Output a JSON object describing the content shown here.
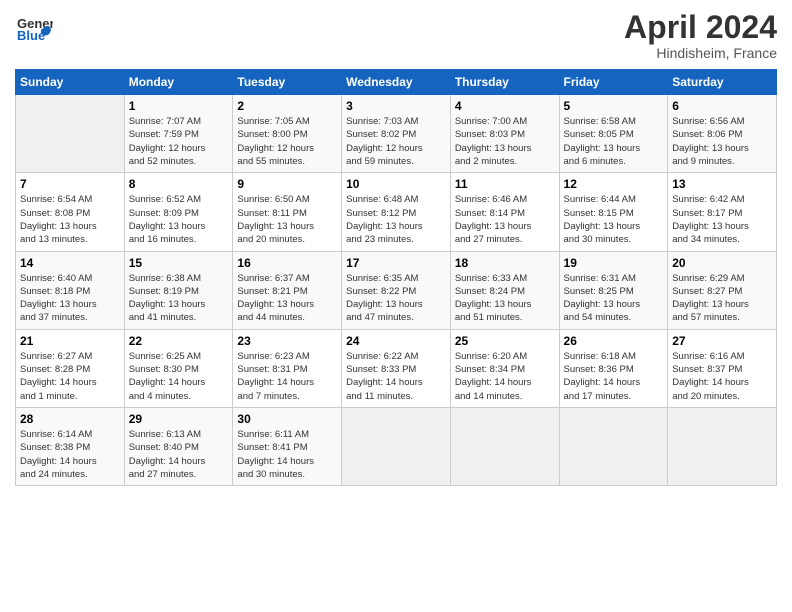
{
  "header": {
    "logo_general": "General",
    "logo_blue": "Blue",
    "title": "April 2024",
    "location": "Hindisheim, France"
  },
  "columns": [
    "Sunday",
    "Monday",
    "Tuesday",
    "Wednesday",
    "Thursday",
    "Friday",
    "Saturday"
  ],
  "weeks": [
    [
      {
        "day": "",
        "info": ""
      },
      {
        "day": "1",
        "info": "Sunrise: 7:07 AM\nSunset: 7:59 PM\nDaylight: 12 hours\nand 52 minutes."
      },
      {
        "day": "2",
        "info": "Sunrise: 7:05 AM\nSunset: 8:00 PM\nDaylight: 12 hours\nand 55 minutes."
      },
      {
        "day": "3",
        "info": "Sunrise: 7:03 AM\nSunset: 8:02 PM\nDaylight: 12 hours\nand 59 minutes."
      },
      {
        "day": "4",
        "info": "Sunrise: 7:00 AM\nSunset: 8:03 PM\nDaylight: 13 hours\nand 2 minutes."
      },
      {
        "day": "5",
        "info": "Sunrise: 6:58 AM\nSunset: 8:05 PM\nDaylight: 13 hours\nand 6 minutes."
      },
      {
        "day": "6",
        "info": "Sunrise: 6:56 AM\nSunset: 8:06 PM\nDaylight: 13 hours\nand 9 minutes."
      }
    ],
    [
      {
        "day": "7",
        "info": "Sunrise: 6:54 AM\nSunset: 8:08 PM\nDaylight: 13 hours\nand 13 minutes."
      },
      {
        "day": "8",
        "info": "Sunrise: 6:52 AM\nSunset: 8:09 PM\nDaylight: 13 hours\nand 16 minutes."
      },
      {
        "day": "9",
        "info": "Sunrise: 6:50 AM\nSunset: 8:11 PM\nDaylight: 13 hours\nand 20 minutes."
      },
      {
        "day": "10",
        "info": "Sunrise: 6:48 AM\nSunset: 8:12 PM\nDaylight: 13 hours\nand 23 minutes."
      },
      {
        "day": "11",
        "info": "Sunrise: 6:46 AM\nSunset: 8:14 PM\nDaylight: 13 hours\nand 27 minutes."
      },
      {
        "day": "12",
        "info": "Sunrise: 6:44 AM\nSunset: 8:15 PM\nDaylight: 13 hours\nand 30 minutes."
      },
      {
        "day": "13",
        "info": "Sunrise: 6:42 AM\nSunset: 8:17 PM\nDaylight: 13 hours\nand 34 minutes."
      }
    ],
    [
      {
        "day": "14",
        "info": "Sunrise: 6:40 AM\nSunset: 8:18 PM\nDaylight: 13 hours\nand 37 minutes."
      },
      {
        "day": "15",
        "info": "Sunrise: 6:38 AM\nSunset: 8:19 PM\nDaylight: 13 hours\nand 41 minutes."
      },
      {
        "day": "16",
        "info": "Sunrise: 6:37 AM\nSunset: 8:21 PM\nDaylight: 13 hours\nand 44 minutes."
      },
      {
        "day": "17",
        "info": "Sunrise: 6:35 AM\nSunset: 8:22 PM\nDaylight: 13 hours\nand 47 minutes."
      },
      {
        "day": "18",
        "info": "Sunrise: 6:33 AM\nSunset: 8:24 PM\nDaylight: 13 hours\nand 51 minutes."
      },
      {
        "day": "19",
        "info": "Sunrise: 6:31 AM\nSunset: 8:25 PM\nDaylight: 13 hours\nand 54 minutes."
      },
      {
        "day": "20",
        "info": "Sunrise: 6:29 AM\nSunset: 8:27 PM\nDaylight: 13 hours\nand 57 minutes."
      }
    ],
    [
      {
        "day": "21",
        "info": "Sunrise: 6:27 AM\nSunset: 8:28 PM\nDaylight: 14 hours\nand 1 minute."
      },
      {
        "day": "22",
        "info": "Sunrise: 6:25 AM\nSunset: 8:30 PM\nDaylight: 14 hours\nand 4 minutes."
      },
      {
        "day": "23",
        "info": "Sunrise: 6:23 AM\nSunset: 8:31 PM\nDaylight: 14 hours\nand 7 minutes."
      },
      {
        "day": "24",
        "info": "Sunrise: 6:22 AM\nSunset: 8:33 PM\nDaylight: 14 hours\nand 11 minutes."
      },
      {
        "day": "25",
        "info": "Sunrise: 6:20 AM\nSunset: 8:34 PM\nDaylight: 14 hours\nand 14 minutes."
      },
      {
        "day": "26",
        "info": "Sunrise: 6:18 AM\nSunset: 8:36 PM\nDaylight: 14 hours\nand 17 minutes."
      },
      {
        "day": "27",
        "info": "Sunrise: 6:16 AM\nSunset: 8:37 PM\nDaylight: 14 hours\nand 20 minutes."
      }
    ],
    [
      {
        "day": "28",
        "info": "Sunrise: 6:14 AM\nSunset: 8:38 PM\nDaylight: 14 hours\nand 24 minutes."
      },
      {
        "day": "29",
        "info": "Sunrise: 6:13 AM\nSunset: 8:40 PM\nDaylight: 14 hours\nand 27 minutes."
      },
      {
        "day": "30",
        "info": "Sunrise: 6:11 AM\nSunset: 8:41 PM\nDaylight: 14 hours\nand 30 minutes."
      },
      {
        "day": "",
        "info": ""
      },
      {
        "day": "",
        "info": ""
      },
      {
        "day": "",
        "info": ""
      },
      {
        "day": "",
        "info": ""
      }
    ]
  ]
}
